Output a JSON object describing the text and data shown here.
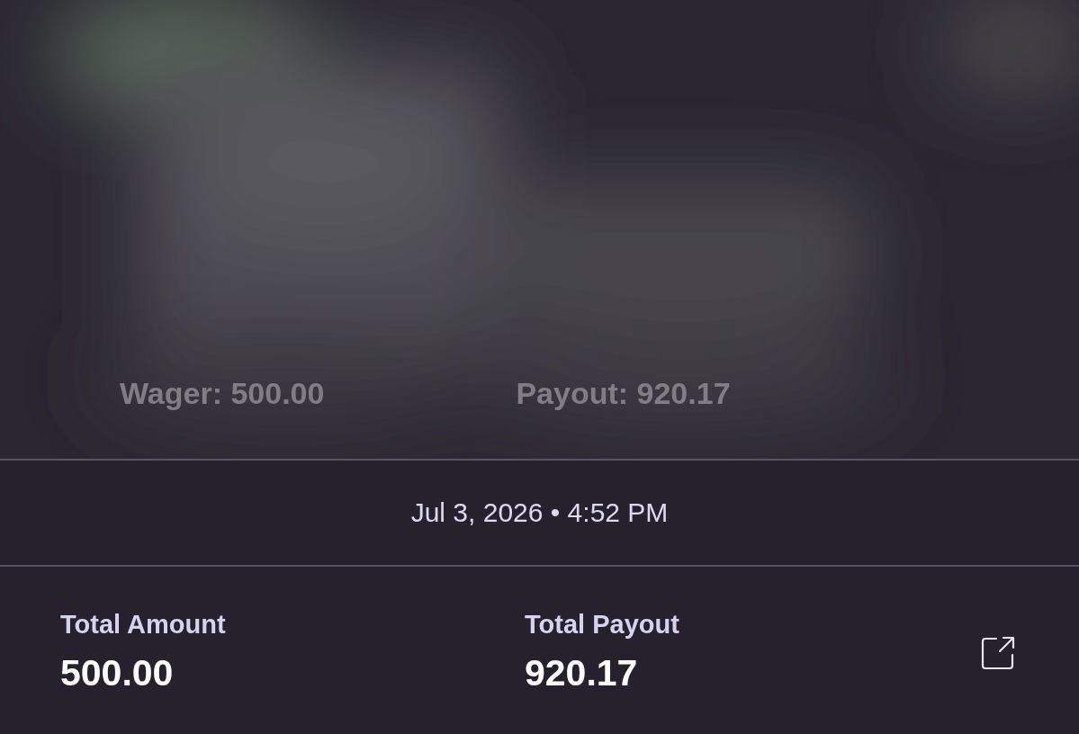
{
  "preview": {
    "kind": "picture",
    "wager": "Wager: 500.00",
    "payout": "Payout: 920.17"
  },
  "timestamp": "Jul 3, 2026 • 4:52 PM",
  "totals": [
    {
      "label": "Total Amount",
      "value": "500.00"
    },
    {
      "label": "Total Payout",
      "value": "920.17"
    }
  ]
}
